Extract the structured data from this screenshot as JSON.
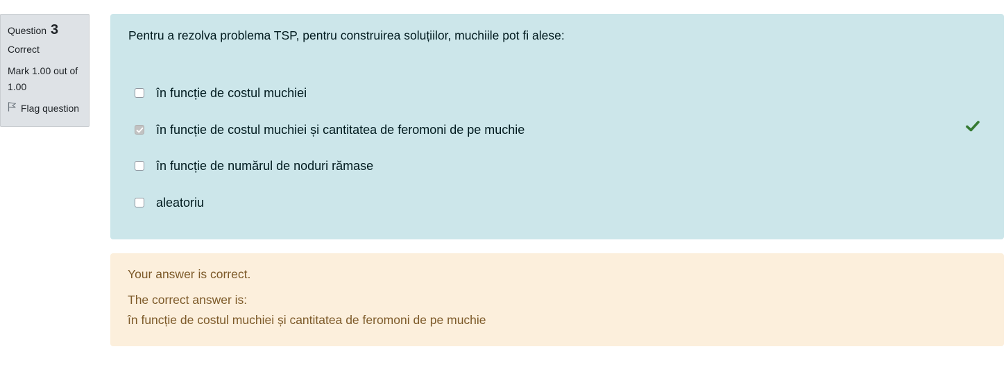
{
  "question_info": {
    "question_label": "Question",
    "question_number": "3",
    "state": "Correct",
    "grade": "Mark 1.00 out of 1.00",
    "flag_label": "Flag question",
    "flag_icon": "flag-icon"
  },
  "question": {
    "text": "Pentru a rezolva problema TSP, pentru construirea soluțiilor, muchiile pot fi alese:",
    "answers": [
      {
        "label": "în funcție de costul muchiei",
        "checked": false
      },
      {
        "label": "în funcție de costul muchiei și cantitatea de feromoni de pe muchie",
        "checked": true
      },
      {
        "label": "în funcție de numărul de noduri rămase",
        "checked": false
      },
      {
        "label": "aleatoriu",
        "checked": false
      }
    ],
    "correct_icon": "check-icon",
    "correct_icon_color": "#357a32"
  },
  "feedback": {
    "general": "Your answer is correct.",
    "right_answer_label": "The correct answer is:",
    "right_answer": "în funcție de costul muchiei și cantitatea de feromoni de pe muchie"
  },
  "colors": {
    "info_bg": "#dee2e6",
    "formulation_bg": "#cce6ea",
    "feedback_bg": "#fcefdc",
    "feedback_text": "#7d5a29"
  }
}
